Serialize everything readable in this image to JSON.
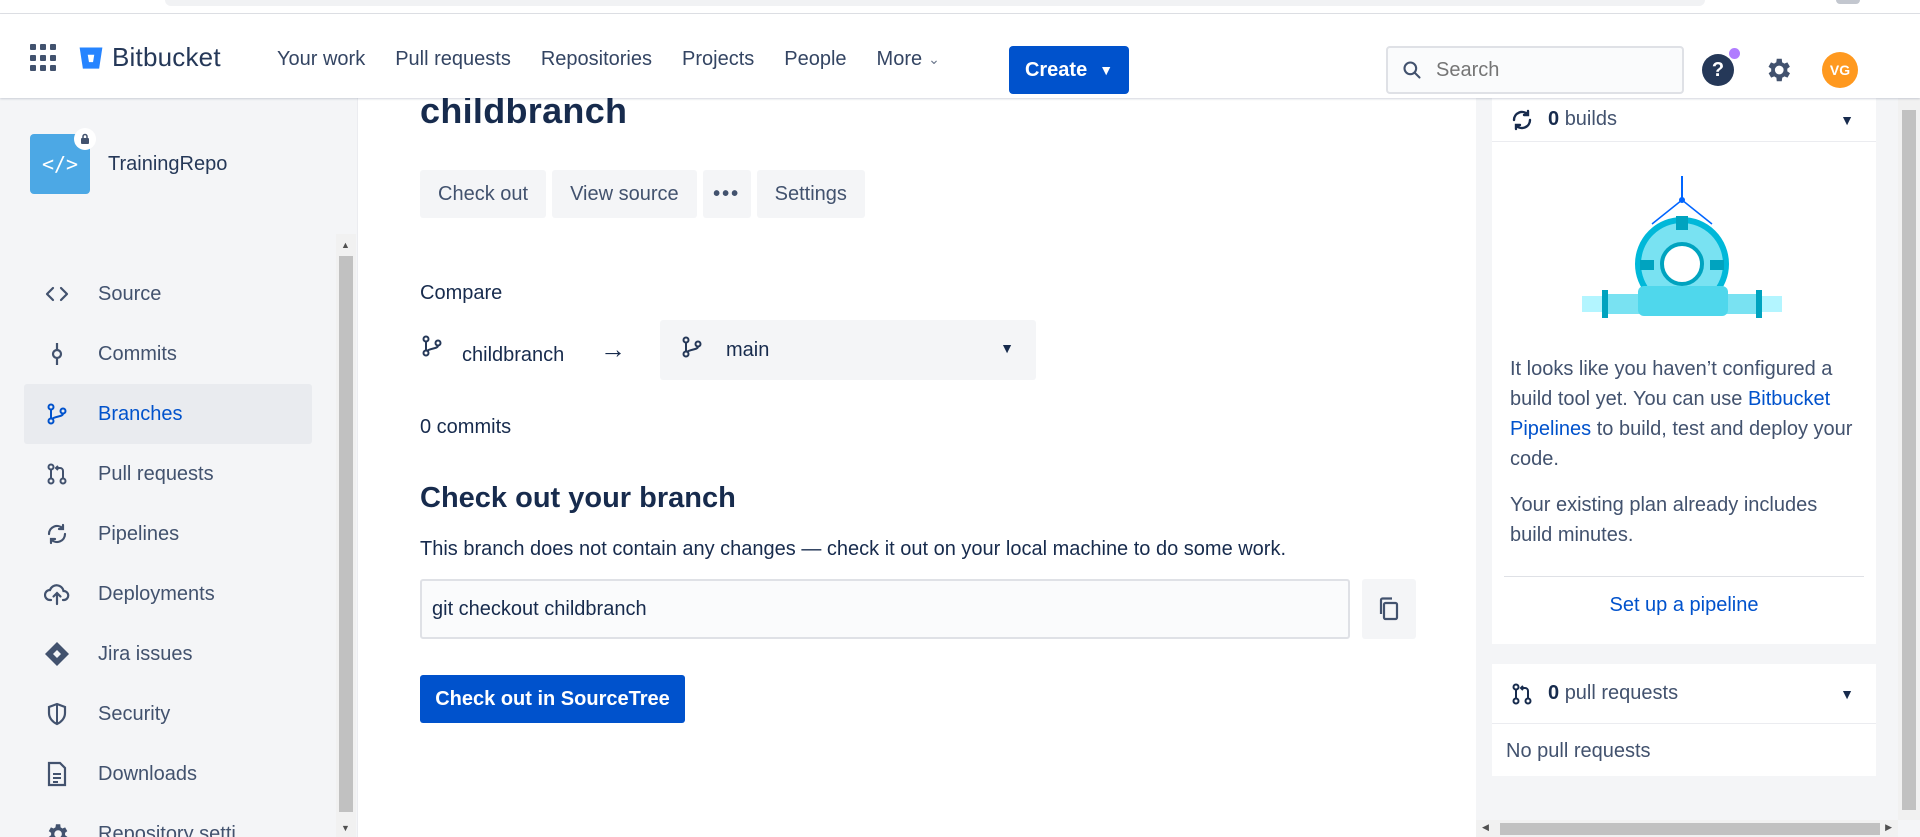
{
  "header": {
    "logo_text": "Bitbucket",
    "nav": [
      {
        "label": "Your work"
      },
      {
        "label": "Pull requests"
      },
      {
        "label": "Repositories"
      },
      {
        "label": "Projects"
      },
      {
        "label": "People"
      },
      {
        "label": "More",
        "has_dropdown": true
      }
    ],
    "create_label": "Create",
    "search_placeholder": "Search",
    "avatar_initials": "VG",
    "accent_color": "#0052cc"
  },
  "sidebar": {
    "repo_name": "TrainingRepo",
    "items": [
      {
        "label": "Source",
        "icon": "code-icon"
      },
      {
        "label": "Commits",
        "icon": "commit-icon"
      },
      {
        "label": "Branches",
        "icon": "branch-icon",
        "active": true
      },
      {
        "label": "Pull requests",
        "icon": "pull-request-icon"
      },
      {
        "label": "Pipelines",
        "icon": "pipelines-icon"
      },
      {
        "label": "Deployments",
        "icon": "cloud-upload-icon"
      },
      {
        "label": "Jira issues",
        "icon": "jira-icon"
      },
      {
        "label": "Security",
        "icon": "shield-icon"
      },
      {
        "label": "Downloads",
        "icon": "document-icon"
      },
      {
        "label": "Repository setti...",
        "icon": "gear-icon"
      }
    ]
  },
  "main": {
    "branch_name": "childbranch",
    "actions": {
      "checkout": "Check out",
      "view_source": "View source",
      "more": "•••",
      "settings": "Settings"
    },
    "compare": {
      "label": "Compare",
      "source": "childbranch",
      "target": "main"
    },
    "commits_count": "0 commits",
    "checkout_title": "Check out your branch",
    "checkout_desc": "This branch does not contain any changes — check it out on your local machine to do some work.",
    "command": "git checkout childbranch",
    "sourcetree_label": "Check out in SourceTree"
  },
  "right": {
    "builds": {
      "count": "0",
      "label": "builds"
    },
    "text1_pre": "It looks like you haven’t configured a build tool yet. You can use ",
    "text1_link": "Bitbucket Pipelines",
    "text1_post": " to build, test and deploy your code.",
    "text2": "Your existing plan already includes build minutes.",
    "setup_link": "Set up a pipeline",
    "pull_requests": {
      "count": "0",
      "label": "pull requests"
    },
    "no_prs": "No pull requests"
  }
}
